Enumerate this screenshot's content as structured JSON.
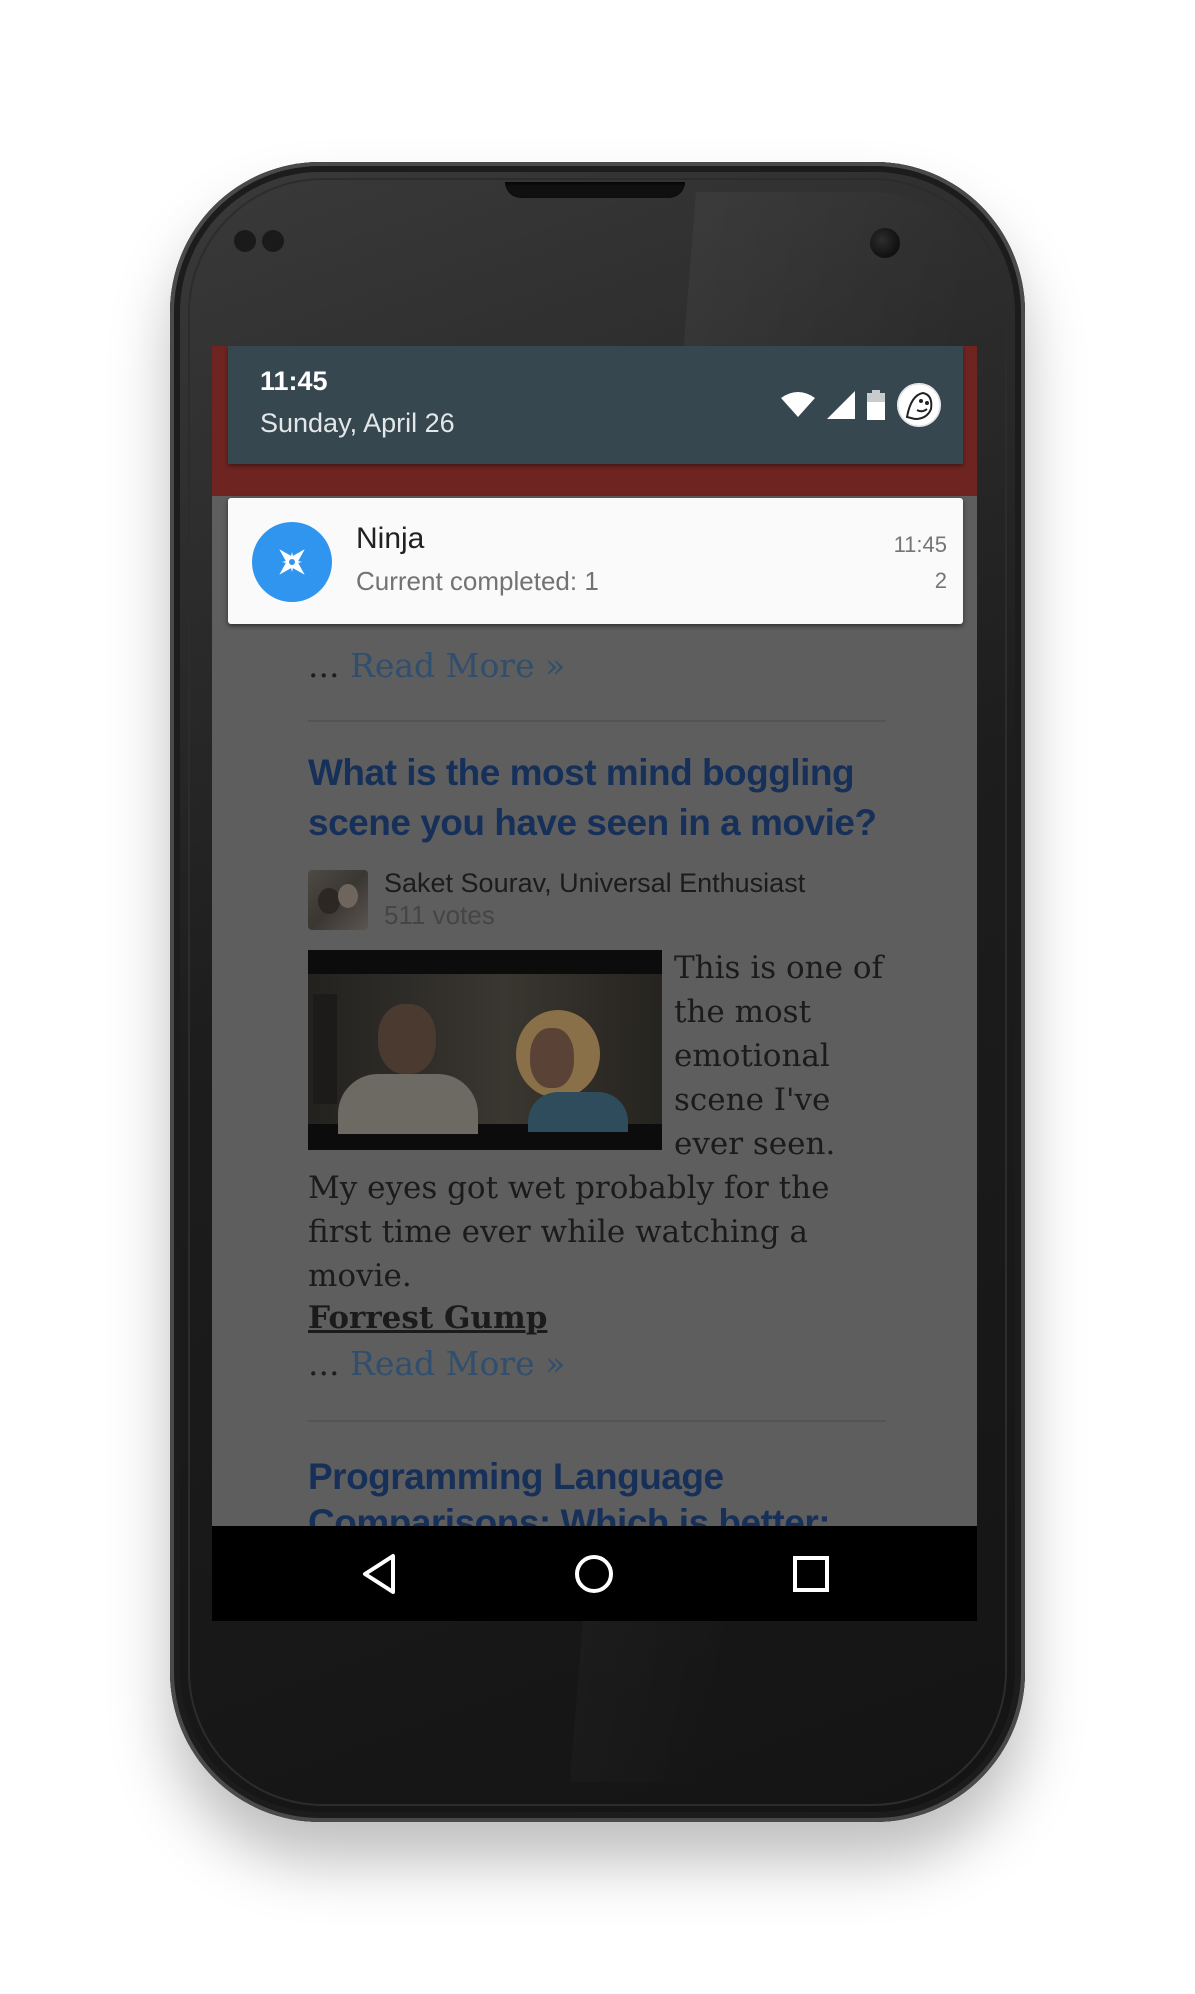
{
  "status_bar": {
    "time": "11:45",
    "date": "Sunday, April 26"
  },
  "notification": {
    "app_name": "Ninja",
    "text": "Current completed: 1",
    "time": "11:45",
    "count": "2",
    "icon": "compass-icon",
    "icon_color": "#2f95ef"
  },
  "page": {
    "read_more_prefix": "...",
    "read_more_label": "Read More »",
    "question_1": "What is the most mind boggling scene you have seen in a movie?",
    "author": {
      "name": "Saket Sourav, Universal Enthusiast",
      "votes": "511 votes"
    },
    "answer_text": "This is one of the most emotional scene I've ever seen. My eyes got wet probably for the first time ever while watching a movie.",
    "movie_link": "Forrest Gump",
    "question_2": "Programming Language Comparisons: Which is better:"
  },
  "colors": {
    "question": "#16305a",
    "link": "#304e6e",
    "shade_header": "#37474f",
    "shade_accent": "#6e2420"
  },
  "nav": {
    "back_icon": "back-triangle-icon",
    "home_icon": "home-circle-icon",
    "recents_icon": "recents-square-icon"
  }
}
